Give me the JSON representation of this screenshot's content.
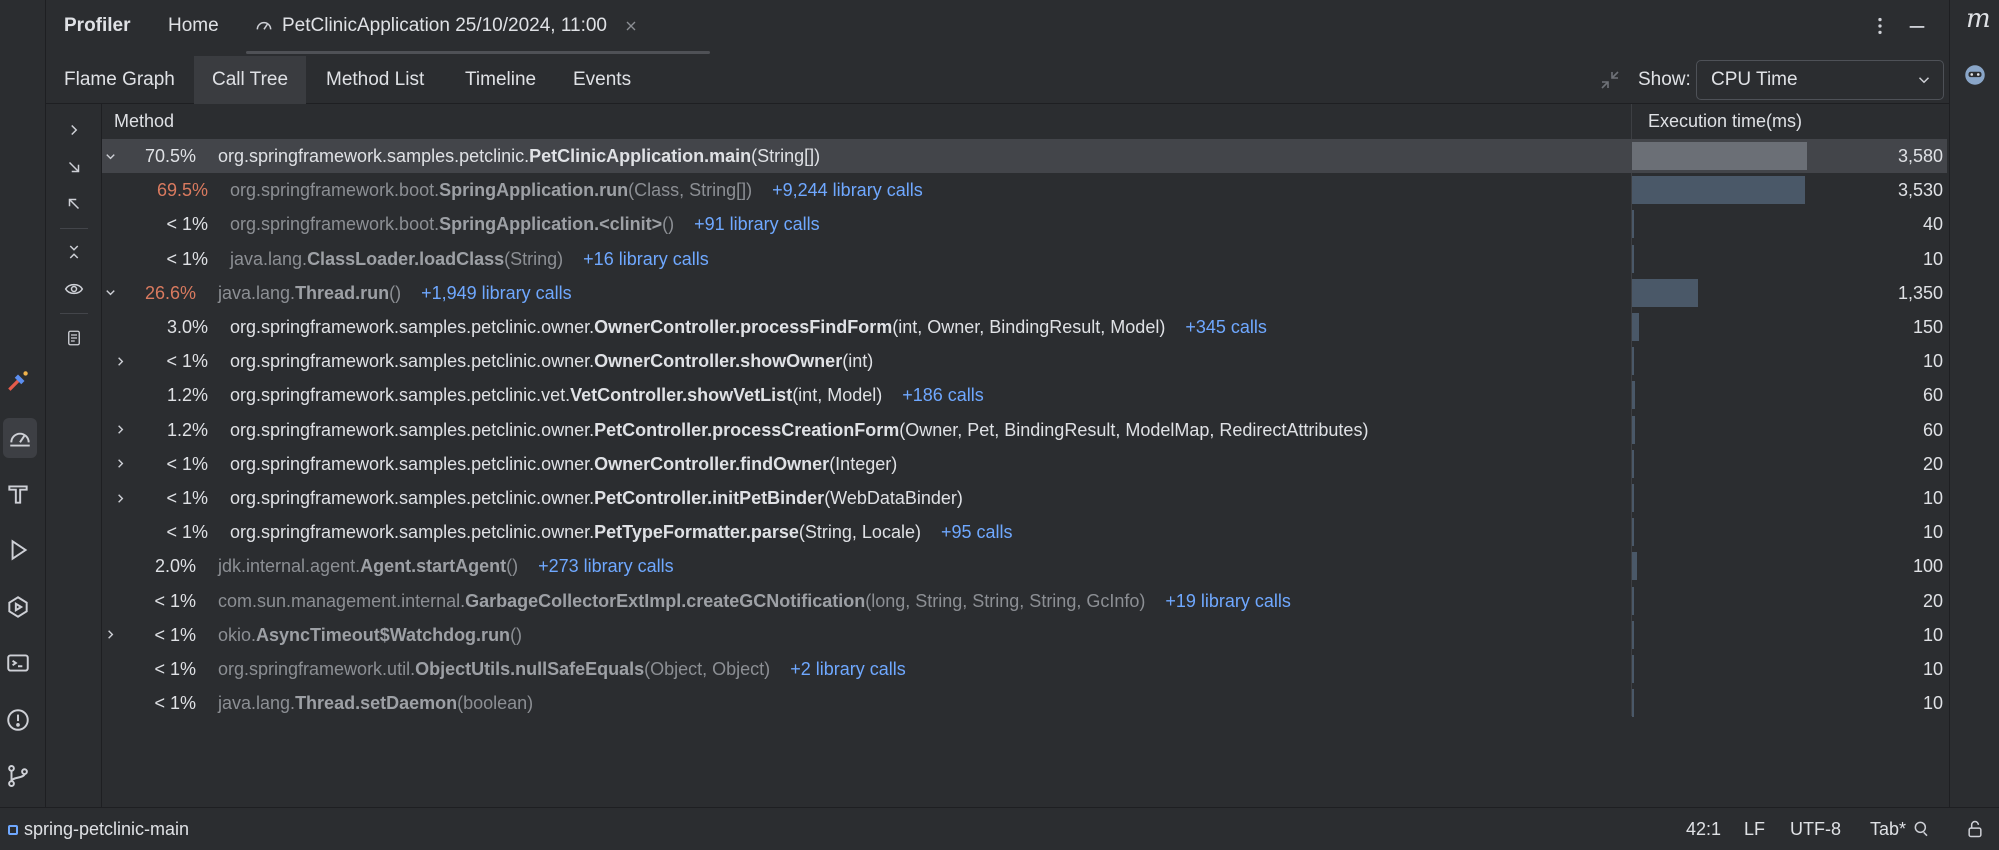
{
  "titlebar": {
    "profiler": "Profiler",
    "home": "Home",
    "session_tab": "PetClinicApplication 25/10/2024, 11:00"
  },
  "subtabs": [
    "Flame Graph",
    "Call Tree",
    "Method List",
    "Timeline",
    "Events"
  ],
  "active_subtab": "Call Tree",
  "show": {
    "label": "Show:",
    "value": "CPU Time"
  },
  "table": {
    "col_method": "Method",
    "col_time": "Execution time(ms)",
    "max_ms": 3580,
    "rows": [
      {
        "indent": 0,
        "expand": "down",
        "pct": "70.5%",
        "hot": false,
        "dim": false,
        "pkg": "org.springframework.samples.petclinic.",
        "name": "PetClinicApplication.main",
        "args": "(String[])",
        "calls": "",
        "ms": "3,580",
        "ms_num": 3580,
        "selected": true
      },
      {
        "indent": 1,
        "expand": "",
        "pct": "69.5%",
        "hot": true,
        "dim": true,
        "pkg": "org.springframework.boot.",
        "name": "SpringApplication.run",
        "args": "(Class, String[])",
        "calls": "+9,244 library calls",
        "ms": "3,530",
        "ms_num": 3530
      },
      {
        "indent": 1,
        "expand": "",
        "pct": "< 1%",
        "hot": false,
        "dim": true,
        "pkg": "org.springframework.boot.",
        "name": "SpringApplication.<clinit>",
        "args": "()",
        "calls": "+91 library calls",
        "ms": "40",
        "ms_num": 40
      },
      {
        "indent": 1,
        "expand": "",
        "pct": "< 1%",
        "hot": false,
        "dim": true,
        "pkg": "java.lang.",
        "name": "ClassLoader.loadClass",
        "args": "(String)",
        "calls": "+16 library calls",
        "ms": "10",
        "ms_num": 10
      },
      {
        "indent": 0,
        "expand": "down",
        "pct": "26.6%",
        "hot": true,
        "dim": true,
        "pkg": "java.lang.",
        "name": "Thread.run",
        "args": "()",
        "calls": "+1,949 library calls",
        "ms": "1,350",
        "ms_num": 1350
      },
      {
        "indent": 1,
        "expand": "",
        "pct": "3.0%",
        "hot": false,
        "dim": false,
        "pkg": "org.springframework.samples.petclinic.owner.",
        "name": "OwnerController.processFindForm",
        "args": "(int, Owner, BindingResult, Model)",
        "calls": "+345 calls",
        "ms": "150",
        "ms_num": 150
      },
      {
        "indent": 1,
        "expand": "right",
        "pct": "< 1%",
        "hot": false,
        "dim": false,
        "pkg": "org.springframework.samples.petclinic.owner.",
        "name": "OwnerController.showOwner",
        "args": "(int)",
        "calls": "",
        "ms": "10",
        "ms_num": 10
      },
      {
        "indent": 1,
        "expand": "",
        "pct": "1.2%",
        "hot": false,
        "dim": false,
        "pkg": "org.springframework.samples.petclinic.vet.",
        "name": "VetController.showVetList",
        "args": "(int, Model)",
        "calls": "+186 calls",
        "ms": "60",
        "ms_num": 60
      },
      {
        "indent": 1,
        "expand": "right",
        "pct": "1.2%",
        "hot": false,
        "dim": false,
        "pkg": "org.springframework.samples.petclinic.owner.",
        "name": "PetController.processCreationForm",
        "args": "(Owner, Pet, BindingResult, ModelMap, RedirectAttributes)",
        "calls": "",
        "ms": "60",
        "ms_num": 60
      },
      {
        "indent": 1,
        "expand": "right",
        "pct": "< 1%",
        "hot": false,
        "dim": false,
        "pkg": "org.springframework.samples.petclinic.owner.",
        "name": "OwnerController.findOwner",
        "args": "(Integer)",
        "calls": "",
        "ms": "20",
        "ms_num": 20
      },
      {
        "indent": 1,
        "expand": "right",
        "pct": "< 1%",
        "hot": false,
        "dim": false,
        "pkg": "org.springframework.samples.petclinic.owner.",
        "name": "PetController.initPetBinder",
        "args": "(WebDataBinder)",
        "calls": "",
        "ms": "10",
        "ms_num": 10
      },
      {
        "indent": 1,
        "expand": "",
        "pct": "< 1%",
        "hot": false,
        "dim": false,
        "pkg": "org.springframework.samples.petclinic.owner.",
        "name": "PetTypeFormatter.parse",
        "args": "(String, Locale)",
        "calls": "+95 calls",
        "ms": "10",
        "ms_num": 10
      },
      {
        "indent": 0,
        "expand": "",
        "pct": "2.0%",
        "hot": false,
        "dim": true,
        "pkg": "jdk.internal.agent.",
        "name": "Agent.startAgent",
        "args": "()",
        "calls": "+273 library calls",
        "ms": "100",
        "ms_num": 100
      },
      {
        "indent": 0,
        "expand": "",
        "pct": "< 1%",
        "hot": false,
        "dim": true,
        "pkg": "com.sun.management.internal.",
        "name": "GarbageCollectorExtImpl.createGCNotification",
        "args": "(long, String, String, String, GcInfo)",
        "calls": "+19 library calls",
        "ms": "20",
        "ms_num": 20
      },
      {
        "indent": 0,
        "expand": "right",
        "pct": "< 1%",
        "hot": false,
        "dim": true,
        "pkg": "okio.",
        "name": "AsyncTimeout$Watchdog.run",
        "args": "()",
        "calls": "",
        "ms": "10",
        "ms_num": 10
      },
      {
        "indent": 0,
        "expand": "",
        "pct": "< 1%",
        "hot": false,
        "dim": true,
        "pkg": "org.springframework.util.",
        "name": "ObjectUtils.nullSafeEquals",
        "args": "(Object, Object)",
        "calls": "+2 library calls",
        "ms": "10",
        "ms_num": 10
      },
      {
        "indent": 0,
        "expand": "",
        "pct": "< 1%",
        "hot": false,
        "dim": true,
        "pkg": "java.lang.",
        "name": "Thread.setDaemon",
        "args": "(boolean)",
        "calls": "",
        "ms": "10",
        "ms_num": 10
      }
    ]
  },
  "status": {
    "project": "spring-petclinic-main",
    "position": "42:1",
    "line_sep": "LF",
    "encoding": "UTF-8",
    "indent": "Tab*"
  },
  "rightbar": {
    "logo": "m"
  },
  "colors": {
    "accent": "#6fa8ff",
    "hot": "#d97a5f",
    "bar": "#4a5868"
  }
}
